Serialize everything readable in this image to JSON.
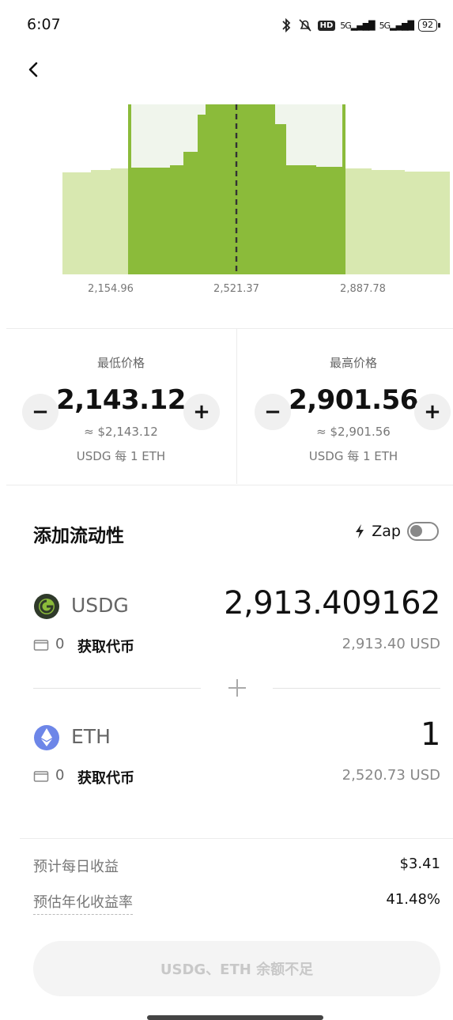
{
  "status_bar": {
    "time": "6:07",
    "hd_label": "HD",
    "signal_1": "5G",
    "signal_2": "5G",
    "battery": "92"
  },
  "chart_data": {
    "type": "area",
    "x_ticks": [
      "2,154.96",
      "2,521.37",
      "2,887.78"
    ],
    "current_price_marker": "2,521.37",
    "selected_range": {
      "min": 2143.12,
      "max": 2901.56
    },
    "colors": {
      "selected": "#8bbb3a",
      "outside": "#d8e8b0",
      "highlight": "#f0f5ec",
      "marker": "#333333"
    }
  },
  "min_price": {
    "title": "最低价格",
    "value": "2,143.12",
    "approx": "≈ $2,143.12",
    "unit": "USDG 每 1 ETH",
    "minus_label": "−",
    "plus_label": "+"
  },
  "max_price": {
    "title": "最高价格",
    "value": "2,901.56",
    "approx": "≈ $2,901.56",
    "unit": "USDG 每 1 ETH",
    "minus_label": "−",
    "plus_label": "+"
  },
  "add_liquidity": {
    "title": "添加流动性",
    "zap_label": "Zap",
    "zap_enabled": false
  },
  "tokens": [
    {
      "symbol": "USDG",
      "amount": "2,913.409162",
      "balance": "0",
      "get_label": "获取代币",
      "usd_value": "2,913.40 USD",
      "icon": "usdg-icon",
      "color": "#2f3a2a"
    },
    {
      "symbol": "ETH",
      "amount": "1",
      "balance": "0",
      "get_label": "获取代币",
      "usd_value": "2,520.73 USD",
      "icon": "eth-icon",
      "color": "#6d86e8"
    }
  ],
  "stats": {
    "daily_label": "预计每日收益",
    "daily_value": "$3.41",
    "apr_label": "预估年化收益率",
    "apr_value": "41.48%"
  },
  "cta": {
    "label": "USDG、ETH 余额不足",
    "enabled": false
  }
}
